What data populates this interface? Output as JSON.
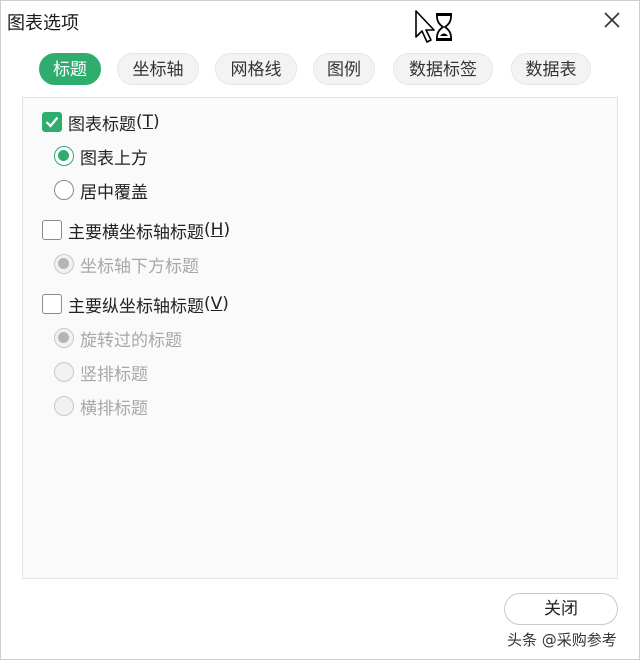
{
  "window": {
    "title": "图表选项"
  },
  "tabs": [
    {
      "label": "标题",
      "active": true
    },
    {
      "label": "坐标轴",
      "active": false
    },
    {
      "label": "网格线",
      "active": false
    },
    {
      "label": "图例",
      "active": false
    },
    {
      "label": "数据标签",
      "active": false
    },
    {
      "label": "数据表",
      "active": false
    }
  ],
  "chart_title": {
    "label": "图表标题",
    "hotkey": "T",
    "checked": true,
    "options": [
      {
        "label": "图表上方",
        "selected": true
      },
      {
        "label": "居中覆盖",
        "selected": false
      }
    ]
  },
  "h_axis_title": {
    "label": "主要横坐标轴标题",
    "hotkey": "H",
    "checked": false,
    "options": [
      {
        "label": "坐标轴下方标题",
        "selected": true,
        "disabled": true
      }
    ]
  },
  "v_axis_title": {
    "label": "主要纵坐标轴标题",
    "hotkey": "V",
    "checked": false,
    "options": [
      {
        "label": "旋转过的标题",
        "selected": true,
        "disabled": true
      },
      {
        "label": "竖排标题",
        "selected": false,
        "disabled": true
      },
      {
        "label": "横排标题",
        "selected": false,
        "disabled": true
      }
    ]
  },
  "footer": {
    "close_label": "关闭"
  },
  "watermark": "头条 @采购参考",
  "colors": {
    "accent": "#2fad6f",
    "disabled_text": "#a8a8a8"
  },
  "icons": {
    "close": "close-icon",
    "cursor": "busy-cursor-icon",
    "check": "checkmark-icon"
  }
}
